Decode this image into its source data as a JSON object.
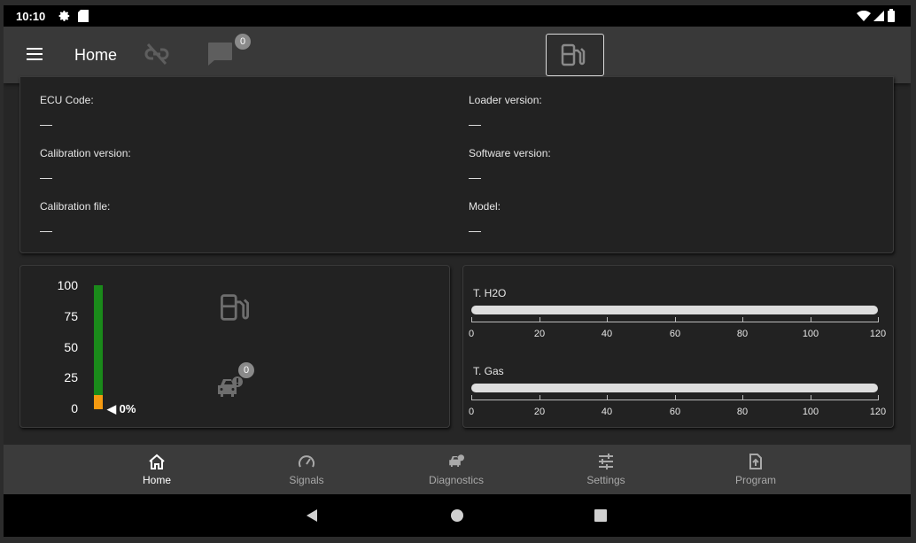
{
  "status_bar": {
    "time": "10:10",
    "icons": [
      "gear-icon",
      "sd-card-icon",
      "wifi-icon",
      "signal-icon",
      "battery-icon"
    ]
  },
  "app_bar": {
    "title": "Home",
    "messages_count": "0",
    "icons": [
      "menu-icon",
      "link-off-icon",
      "chat-icon",
      "fuel-pump-icon"
    ]
  },
  "info": {
    "ecu_code_label": "ECU Code:",
    "ecu_code_value": "—",
    "loader_version_label": "Loader version:",
    "loader_version_value": "—",
    "calibration_version_label": "Calibration version:",
    "calibration_version_value": "—",
    "software_version_label": "Software version:",
    "software_version_value": "—",
    "calibration_file_label": "Calibration file:",
    "calibration_file_value": "—",
    "model_label": "Model:",
    "model_value": "—"
  },
  "level_gauge": {
    "ticks": [
      "100",
      "75",
      "50",
      "25",
      "0"
    ],
    "value_label": "◀ 0%",
    "level_fraction": 0.0,
    "fuel_icon": "fuel-pump-icon",
    "diagnostic_icon": "car-alert-icon",
    "diagnostic_count": "0"
  },
  "temperatures": {
    "h2o_label": "T. H2O",
    "gas_label": "T. Gas",
    "scale": [
      "0",
      "20",
      "40",
      "60",
      "80",
      "100",
      "120"
    ]
  },
  "bottom_nav": {
    "items": [
      {
        "label": "Home",
        "icon": "home-icon"
      },
      {
        "label": "Signals",
        "icon": "speedometer-icon"
      },
      {
        "label": "Diagnostics",
        "icon": "car-alert-icon"
      },
      {
        "label": "Settings",
        "icon": "tune-icon"
      },
      {
        "label": "Program",
        "icon": "file-upload-icon"
      }
    ]
  },
  "colors": {
    "gauge_green": "#1a8a1a",
    "gauge_orange": "#f59a10",
    "badge": "#8a8a8a"
  }
}
